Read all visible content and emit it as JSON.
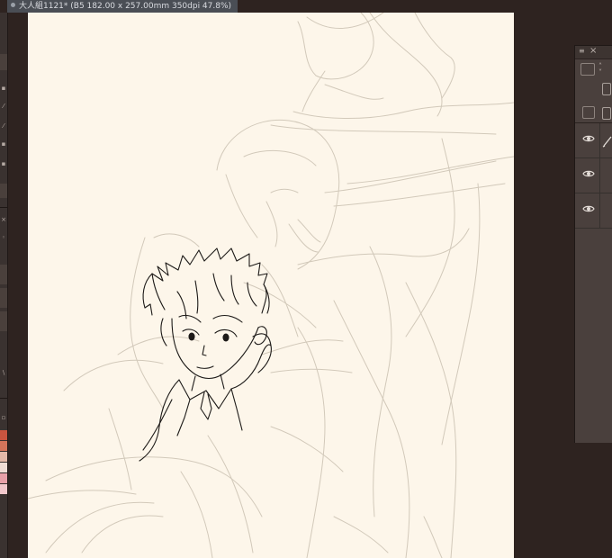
{
  "document": {
    "tab_title": "大人組1121* (B5 182.00 x 257.00mm 350dpi 47.8%)"
  },
  "colors": {
    "background": "#2e2320",
    "canvas": "#fdf6ea",
    "panel": "#4a403d",
    "sketch": "#ccc3b4",
    "lineart": "#1a1a1a"
  },
  "left_swatches": [
    "#c9543f",
    "#d4745a",
    "#e3b8a8",
    "#f0dcd4",
    "#e8a0a8",
    "#f2c8cc"
  ],
  "layer_panel": {
    "icons": [
      "menu-icon",
      "close-icon",
      "rectangle-icon",
      "chevron-updown-icon",
      "copy-layers-icon",
      "new-layer-icon",
      "folder-icon"
    ],
    "layers": [
      {
        "visible": true,
        "icon": "eye-icon",
        "editing": true
      },
      {
        "visible": true,
        "icon": "eye-icon",
        "editing": false
      },
      {
        "visible": true,
        "icon": "eye-icon",
        "editing": false
      }
    ]
  }
}
